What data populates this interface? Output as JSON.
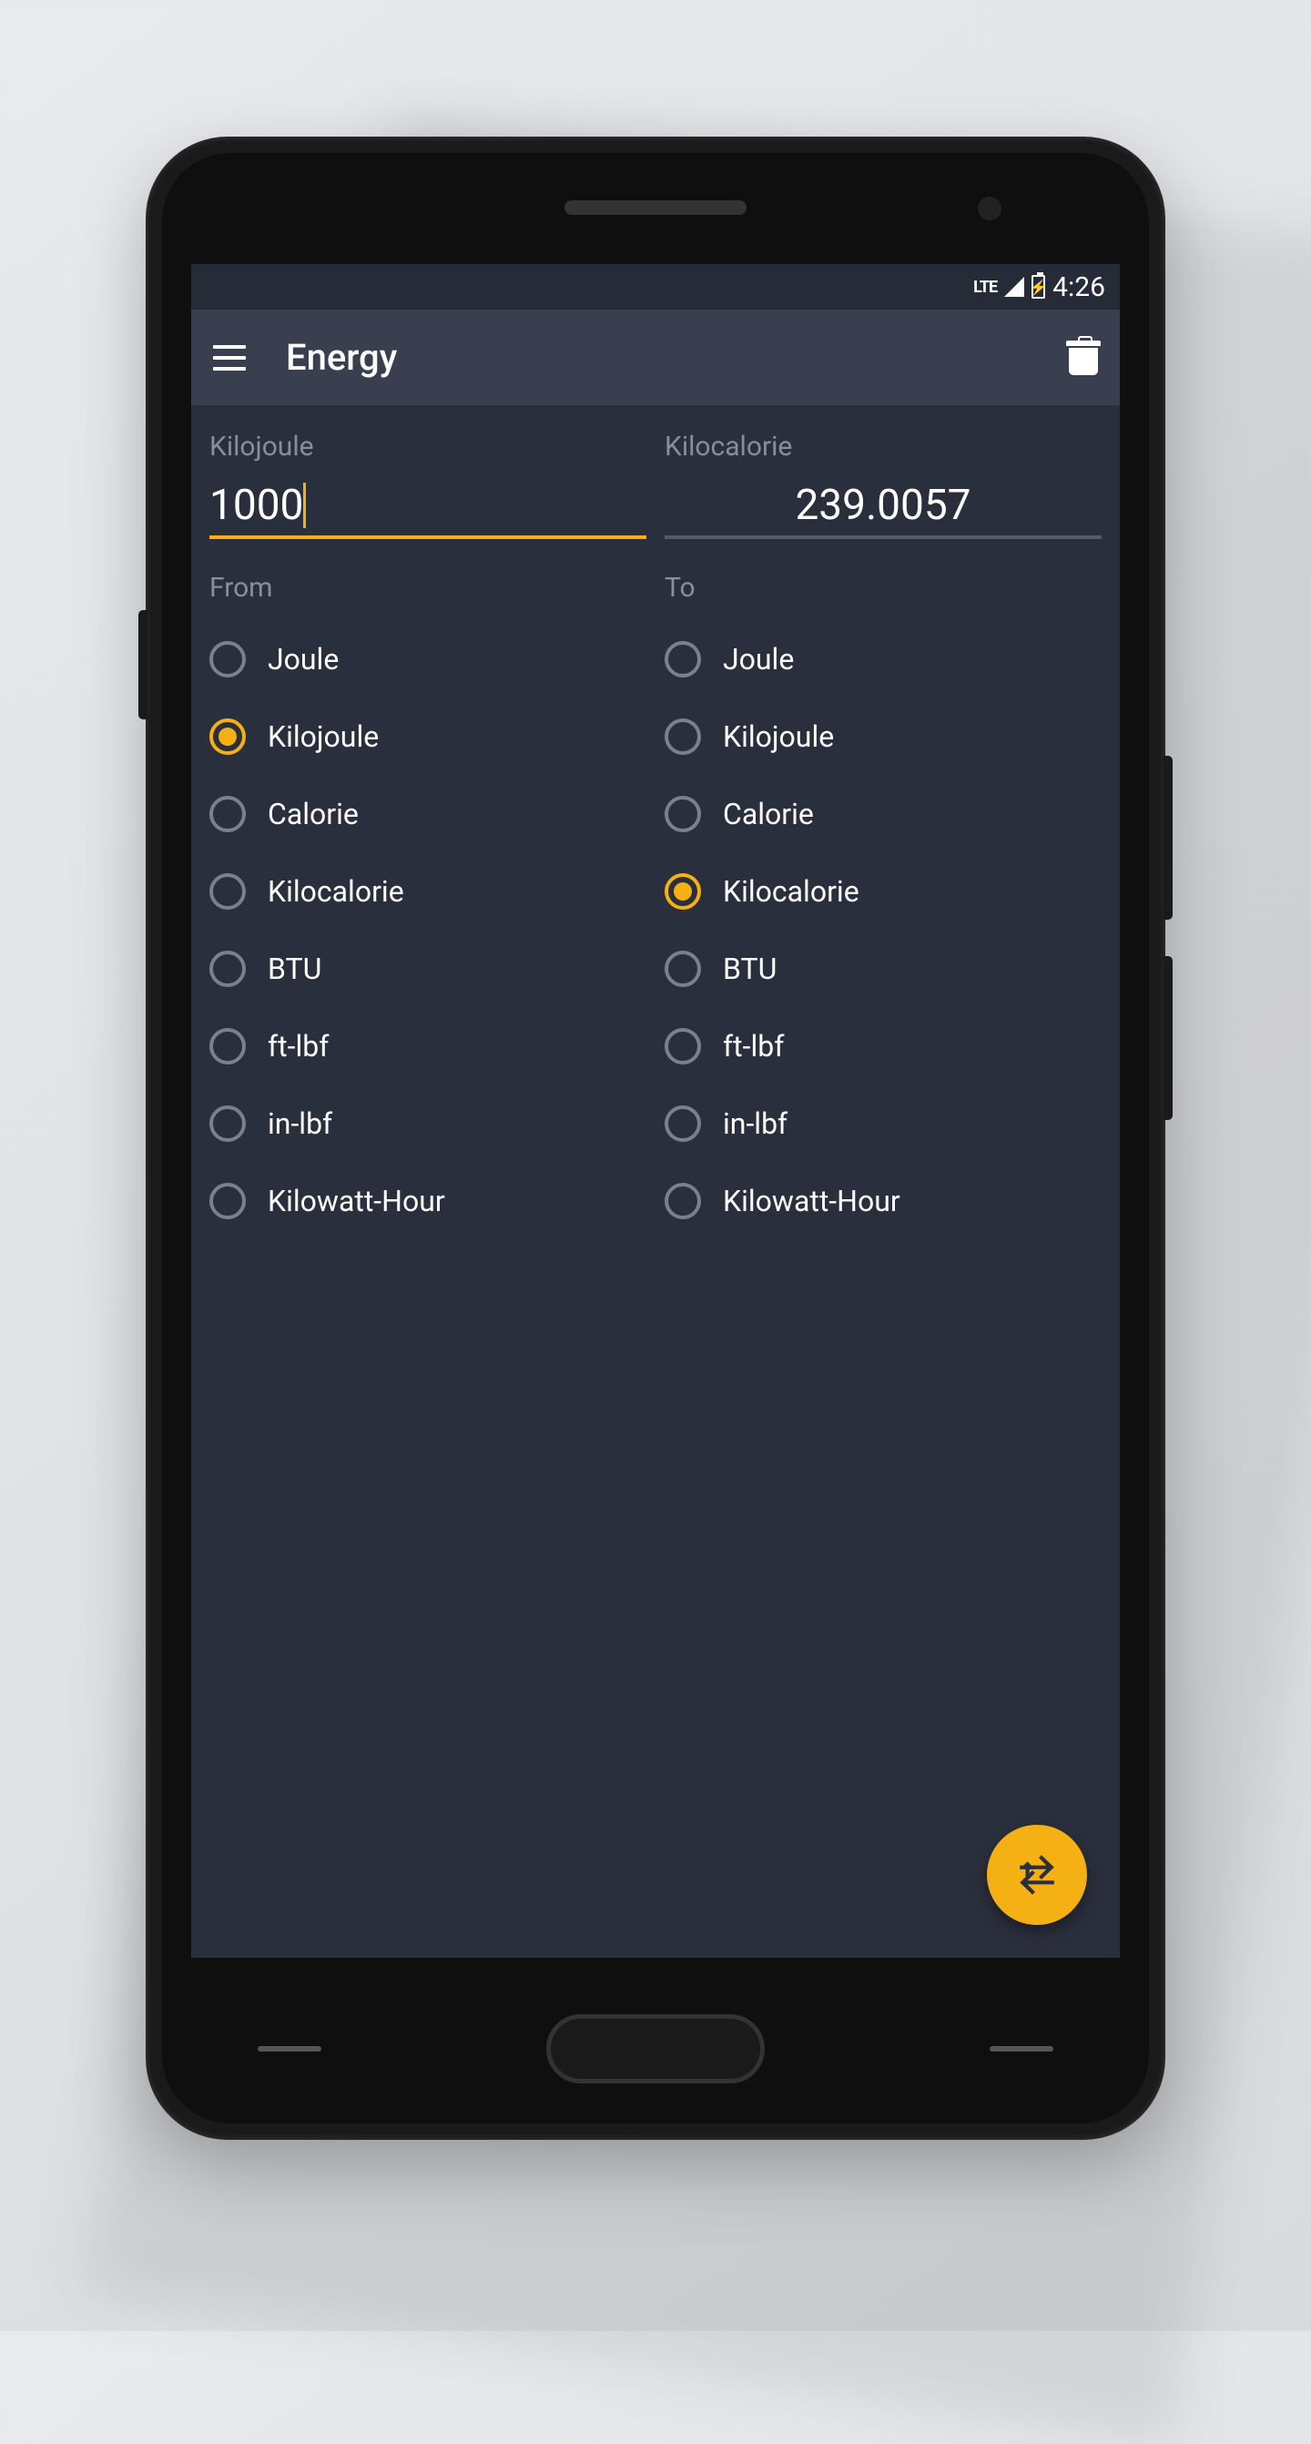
{
  "status": {
    "network": "LTE",
    "time": "4:26"
  },
  "appbar": {
    "title": "Energy"
  },
  "from": {
    "unit_label": "Kilojoule",
    "value": "1000",
    "section_label": "From",
    "selected_index": 1
  },
  "to": {
    "unit_label": "Kilocalorie",
    "value": "239.0057",
    "section_label": "To",
    "selected_index": 3
  },
  "units": [
    "Joule",
    "Kilojoule",
    "Calorie",
    "Kilocalorie",
    "BTU",
    "ft-lbf",
    "in-lbf",
    "Kilowatt-Hour"
  ]
}
